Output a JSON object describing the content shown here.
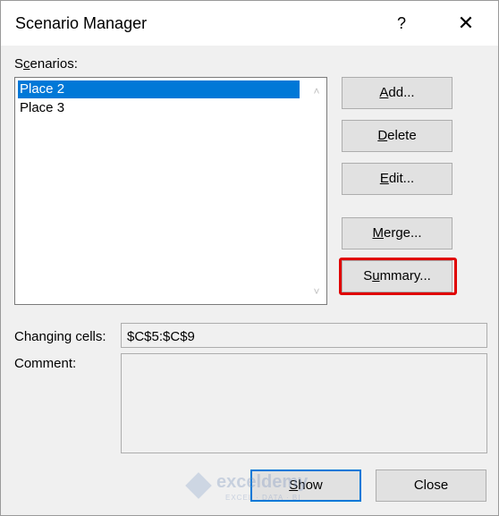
{
  "window": {
    "title": "Scenario Manager",
    "help_glyph": "?",
    "close_glyph": "✕"
  },
  "scenarios": {
    "label_pre": "S",
    "label_ul": "c",
    "label_post": "enarios:",
    "items": [
      {
        "label": "Place 2",
        "selected": true
      },
      {
        "label": "Place 3",
        "selected": false
      }
    ]
  },
  "buttons": {
    "add": {
      "pre": "",
      "ul": "A",
      "post": "dd..."
    },
    "delete": {
      "pre": "",
      "ul": "D",
      "post": "elete"
    },
    "edit": {
      "pre": "",
      "ul": "E",
      "post": "dit..."
    },
    "merge": {
      "pre": "",
      "ul": "M",
      "post": "erge..."
    },
    "summary": {
      "pre": "S",
      "ul": "u",
      "post": "mmary..."
    },
    "show": {
      "pre": "",
      "ul": "S",
      "post": "how"
    },
    "close": {
      "label": "Close"
    }
  },
  "changing_cells": {
    "label": "Changing cells:",
    "value": "$C$5:$C$9"
  },
  "comment": {
    "label": "Comment:",
    "value": ""
  },
  "watermark": {
    "name": "exceldemy",
    "tagline": "EXCEL · DATA · BI"
  },
  "colors": {
    "selection": "#0078d7",
    "highlight": "#e00000",
    "default_button_border": "#0078d7"
  }
}
